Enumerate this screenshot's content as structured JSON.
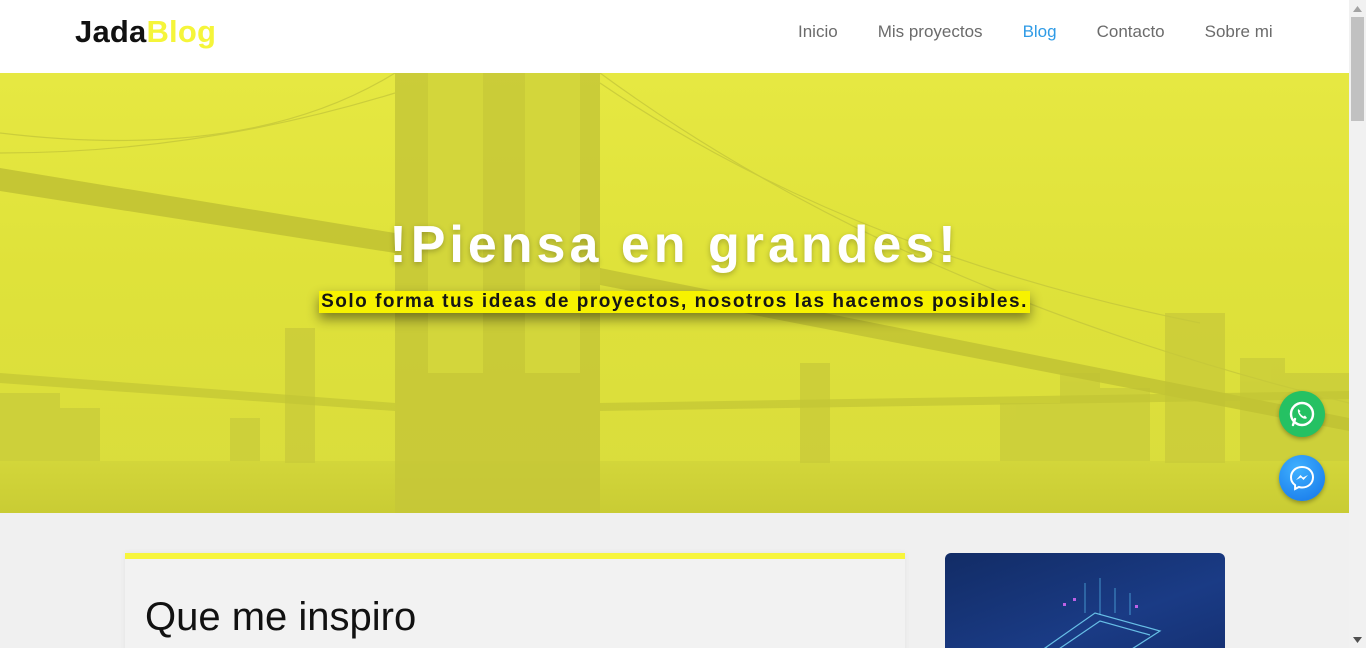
{
  "brand": {
    "part1": "Jada",
    "part2": "Blog"
  },
  "nav": [
    {
      "label": "Inicio",
      "active": false
    },
    {
      "label": "Mis proyectos",
      "active": false
    },
    {
      "label": "Blog",
      "active": true
    },
    {
      "label": "Contacto",
      "active": false
    },
    {
      "label": "Sobre mi",
      "active": false
    }
  ],
  "hero": {
    "title": "!Piensa en grandes!",
    "subtitle": "Solo forma tus ideas de proyectos, nosotros las hacemos posibles."
  },
  "floating": {
    "whatsapp_icon": "whatsapp-icon",
    "messenger_icon": "messenger-icon"
  },
  "main": {
    "section_title": "Que me inspiro"
  },
  "colors": {
    "accent": "#f7f53d",
    "active_link": "#2f9be6",
    "whatsapp": "#25c163",
    "messenger": "#1e8ef5"
  }
}
